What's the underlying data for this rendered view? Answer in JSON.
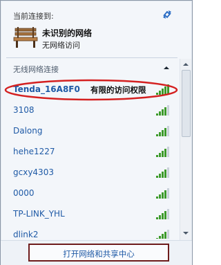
{
  "header": {
    "label": "当前连接到:"
  },
  "current": {
    "name": "未识别的网络",
    "status": "无网络访问"
  },
  "section": {
    "title": "无线网络连接"
  },
  "networks": [
    {
      "ssid": "Tenda_16A8F0",
      "status": "有限的访问权限",
      "bars": 5
    },
    {
      "ssid": "3108",
      "bars": 4
    },
    {
      "ssid": "Dalong",
      "bars": 4
    },
    {
      "ssid": "hehe1227",
      "bars": 4
    },
    {
      "ssid": "gcxy4303",
      "bars": 4
    },
    {
      "ssid": "0000",
      "bars": 4
    },
    {
      "ssid": "TP-LINK_YHL",
      "bars": 4
    },
    {
      "ssid": "dlink2",
      "bars": 4
    }
  ],
  "footer": {
    "link_label": "打开网络和共享中心"
  },
  "colors": {
    "link": "#1f5aa6",
    "signal": "#3c9a2a",
    "annotation": "#d42020",
    "frame": "#6d1b1b"
  }
}
